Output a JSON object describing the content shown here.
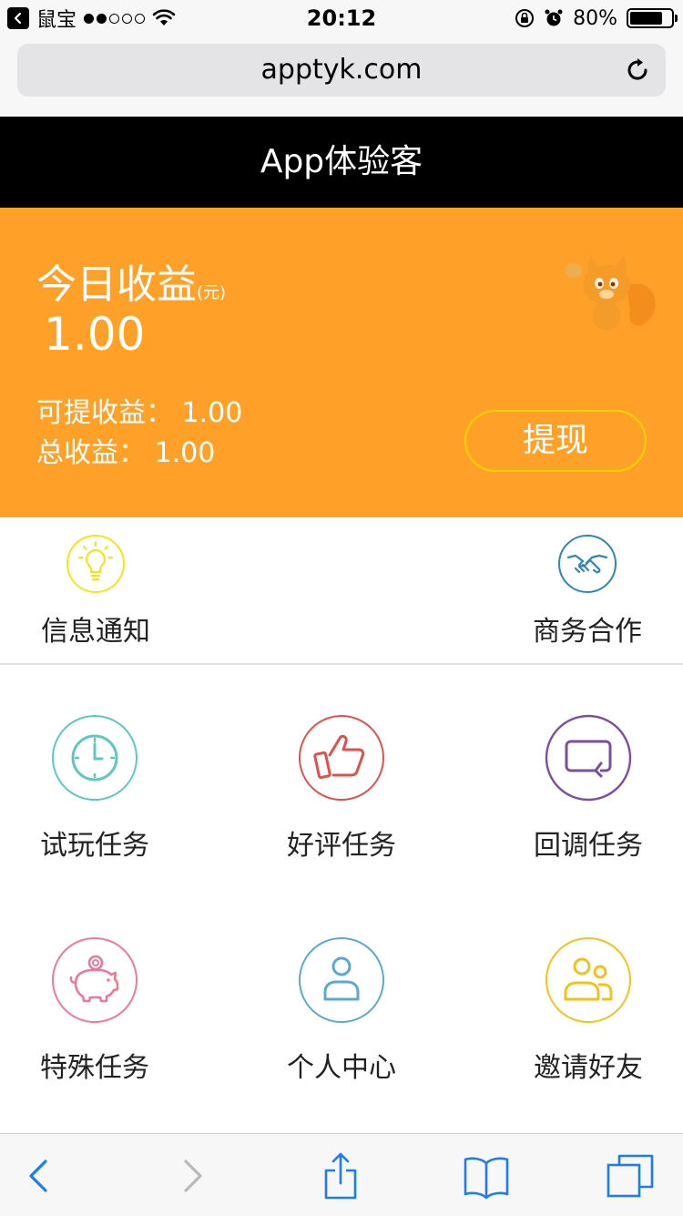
{
  "status_bar": {
    "carrier": "鼠宝",
    "time": "20:12",
    "battery": "80%",
    "battery_level": 0.8
  },
  "browser": {
    "url": "apptyk.com"
  },
  "header": {
    "title": "App体验客"
  },
  "earnings": {
    "today_label": "今日收益",
    "unit": "(元)",
    "today_value": "1.00",
    "available_text": "可提收益： 1.00",
    "total_text": "总收益： 1.00",
    "withdraw_label": "提现"
  },
  "top_features": [
    {
      "label": "信息通知",
      "icon": "lightbulb-icon",
      "color": "#f3e51a"
    },
    {
      "label": "商务合作",
      "icon": "handshake-icon",
      "color": "#2f86b8"
    }
  ],
  "grid": [
    {
      "label": "试玩任务",
      "icon": "clock-icon",
      "color": "#5cc8bf"
    },
    {
      "label": "好评任务",
      "icon": "thumbs-up-icon",
      "color": "#e0504c"
    },
    {
      "label": "回调任务",
      "icon": "callback-icon",
      "color": "#7d4ea0"
    },
    {
      "label": "特殊任务",
      "icon": "piggy-bank-icon",
      "color": "#ee7896"
    },
    {
      "label": "个人中心",
      "icon": "user-icon",
      "color": "#5aa8d3"
    },
    {
      "label": "邀请好友",
      "icon": "users-icon",
      "color": "#f0c21b"
    }
  ],
  "colors": {
    "earnings_bg": "#ffa128",
    "header_bg": "#000000",
    "withdraw_border": "#ffd400",
    "toolbar_blue": "#1a7cf6"
  }
}
